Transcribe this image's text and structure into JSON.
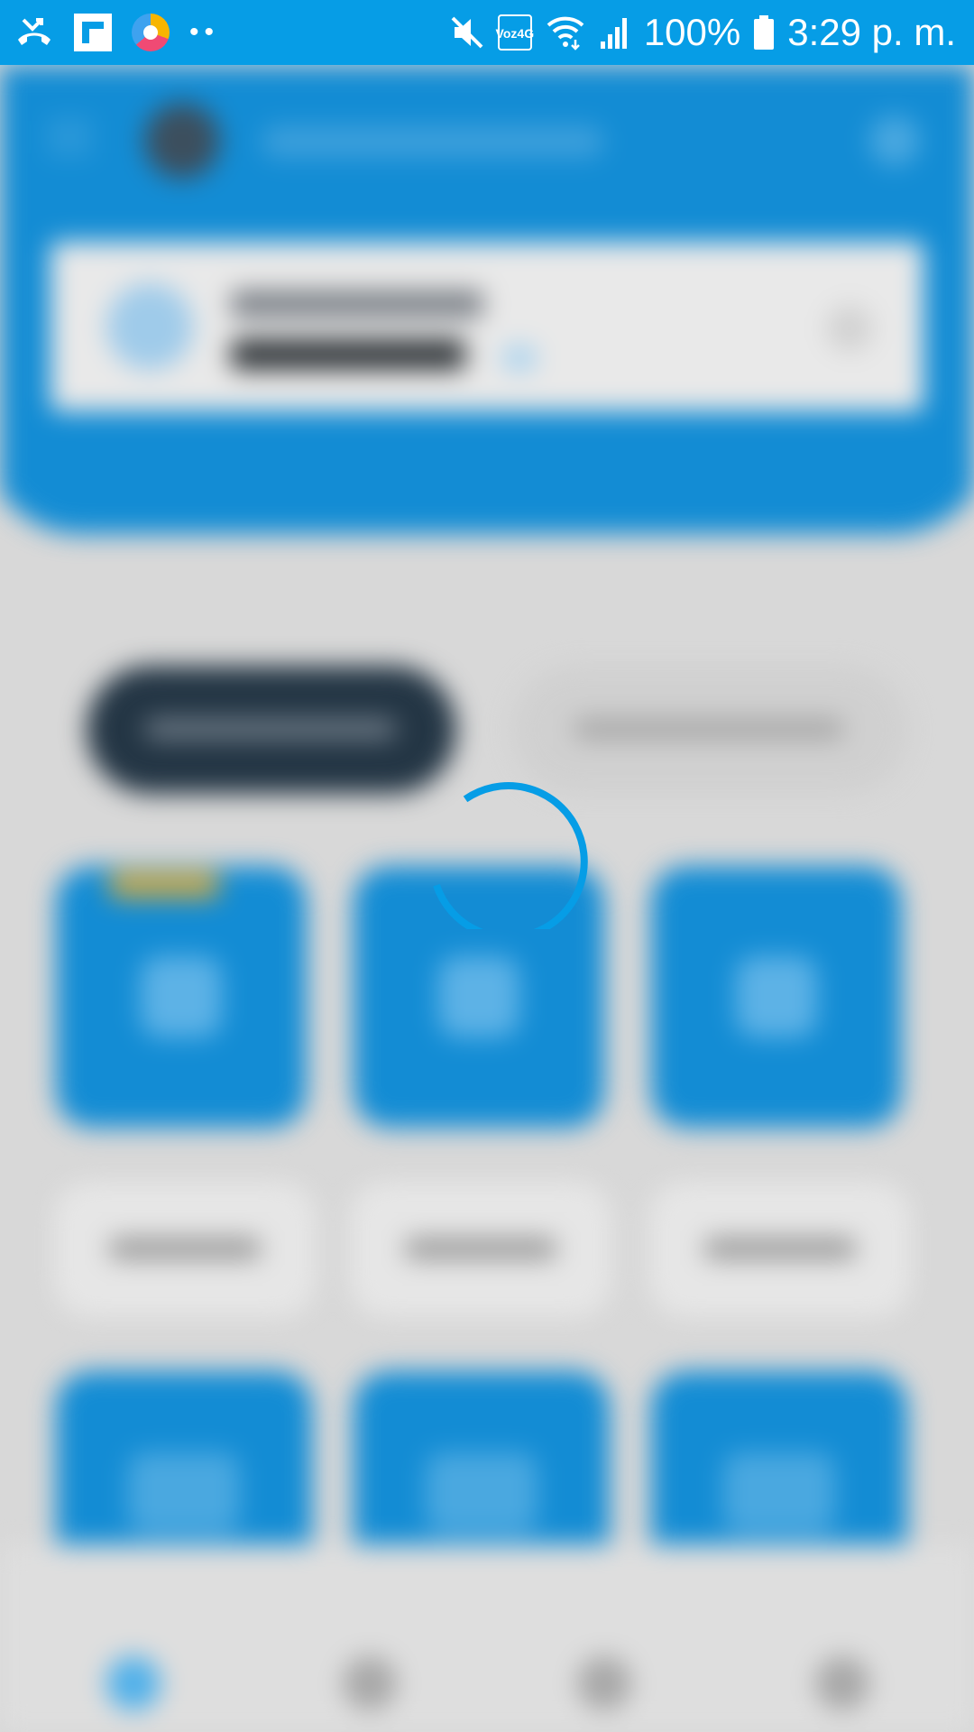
{
  "status_bar": {
    "battery_percent": "100%",
    "time": "3:29 p. m.",
    "network_badge_top": "Voz",
    "network_badge_bottom": "4G",
    "overflow_dots": "••",
    "left_icons": [
      "missed-call-icon",
      "flipboard-app-icon",
      "browser-app-icon",
      "more-notifications-icon"
    ],
    "right_icons": [
      "mute-icon",
      "volte-4g-icon",
      "wifi-icon",
      "signal-icon",
      "battery-icon"
    ]
  },
  "screen_state": {
    "loading": true,
    "background_blurred": true
  },
  "colors": {
    "status_bar": "#069de6",
    "primary": "#138cd4",
    "spinner": "#069de6",
    "dark_segment": "#233544",
    "page_bg": "#d8d8d8"
  }
}
